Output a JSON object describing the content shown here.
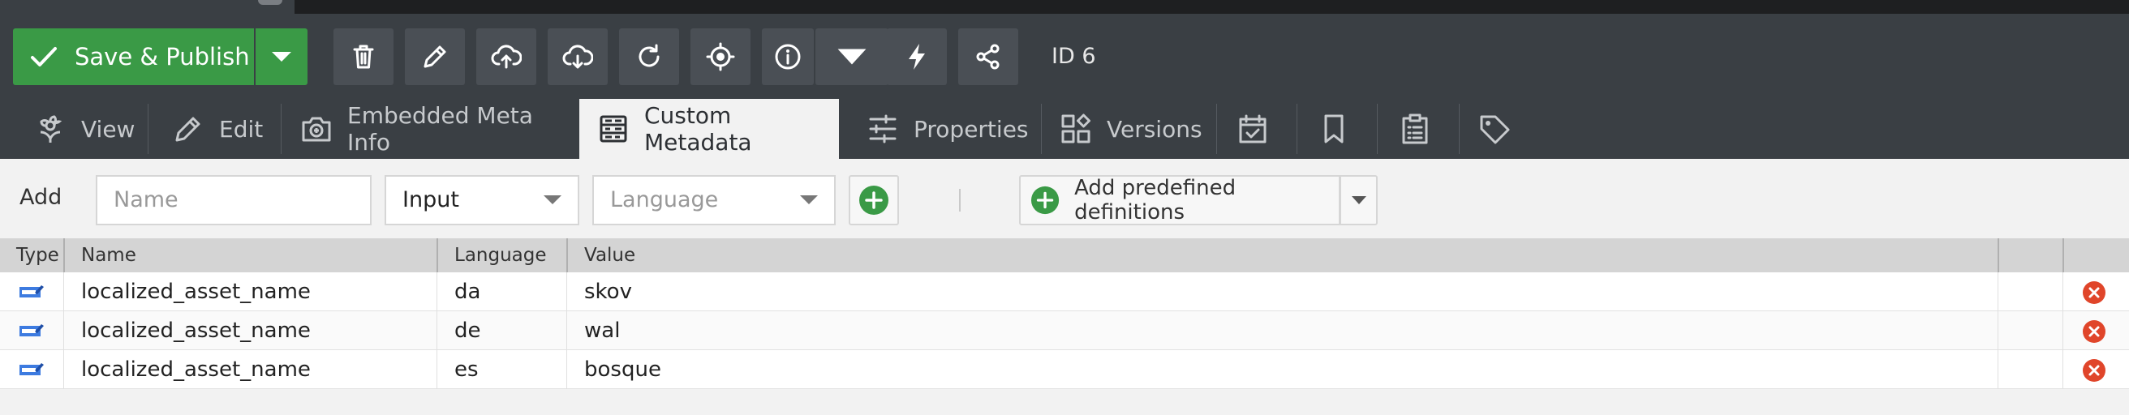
{
  "toolbar": {
    "save_label": "Save & Publish",
    "id_label": "ID 6",
    "buttons": [
      "trash-icon",
      "pencil-icon",
      "upload-cloud-icon",
      "download-cloud-icon",
      "reload-icon",
      "target-icon",
      "info-icon",
      "chevron-down-icon",
      "bolt-icon",
      "share-icon"
    ]
  },
  "tabs": [
    {
      "label": "View",
      "icon": "flower-icon"
    },
    {
      "label": "Edit",
      "icon": "pencil-icon"
    },
    {
      "label": "Embedded Meta Info",
      "icon": "camera-icon"
    },
    {
      "label": "Custom Metadata",
      "icon": "metadata-icon",
      "active": true
    },
    {
      "label": "Properties",
      "icon": "sliders-icon"
    },
    {
      "label": "Versions",
      "icon": "versions-icon"
    },
    {
      "label": "",
      "icon": "calendar-check-icon"
    },
    {
      "label": "",
      "icon": "bookmark-icon"
    },
    {
      "label": "",
      "icon": "clipboard-list-icon"
    },
    {
      "label": "",
      "icon": "tag-icon"
    }
  ],
  "add_row": {
    "label": "Add",
    "name_placeholder": "Name",
    "type_value": "Input",
    "language_placeholder": "Language",
    "predefined_label": "Add predefined definitions"
  },
  "grid": {
    "headers": {
      "type": "Type",
      "name": "Name",
      "language": "Language",
      "value": "Value"
    },
    "rows": [
      {
        "type": "input",
        "name": "localized_asset_name",
        "language": "da",
        "value": "skov"
      },
      {
        "type": "input",
        "name": "localized_asset_name",
        "language": "de",
        "value": "wal"
      },
      {
        "type": "input",
        "name": "localized_asset_name",
        "language": "es",
        "value": "bosque"
      }
    ]
  },
  "colors": {
    "accent_green": "#3a9a46",
    "toolbar_bg": "#3a3f44",
    "delete_red": "#e0452a",
    "type_icon_blue": "#3d7be0"
  }
}
